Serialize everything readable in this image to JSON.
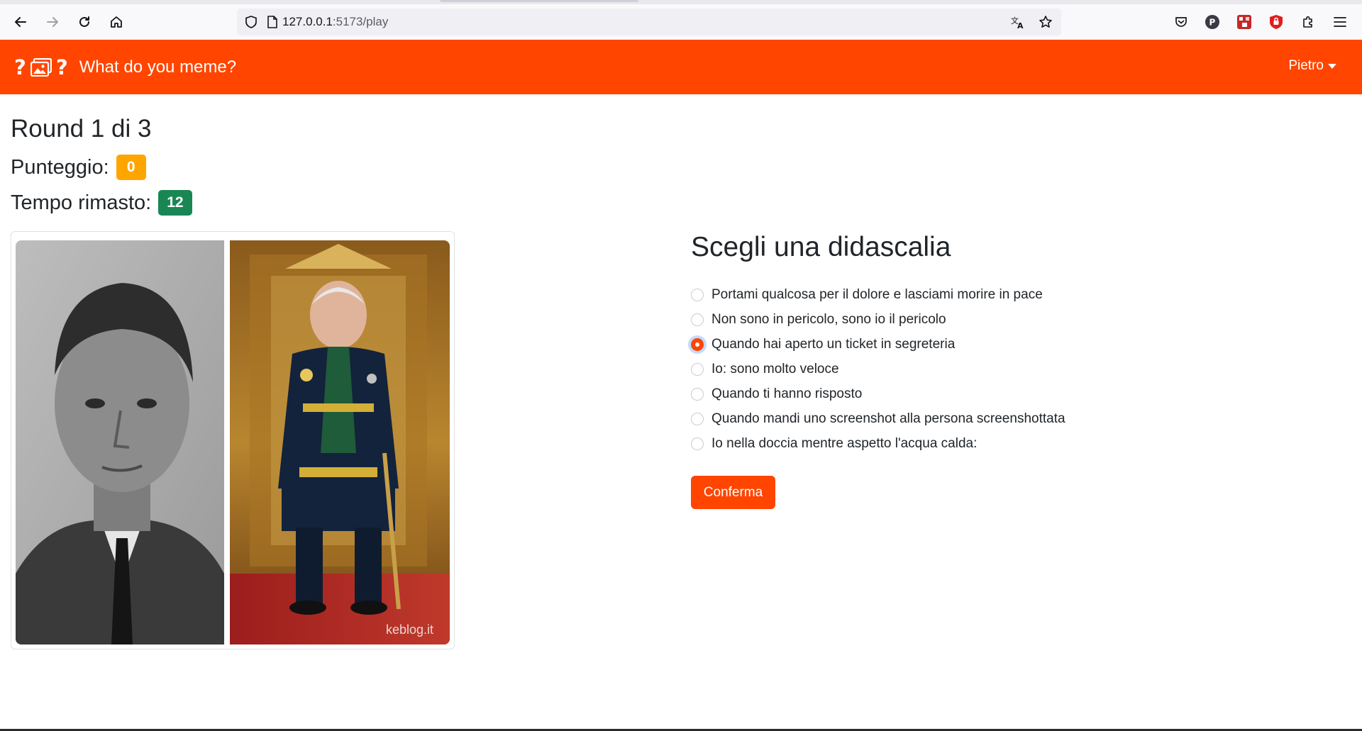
{
  "browser": {
    "url_host": "127.0.0.1",
    "url_path": ":5173/play"
  },
  "navbar": {
    "brand_left": "?",
    "brand_right": "?",
    "title": "What do you meme?",
    "user": "Pietro"
  },
  "game": {
    "round_label": "Round 1 di 3",
    "score_label": "Punteggio:",
    "score_value": "0",
    "time_label": "Tempo rimasto:",
    "time_value": "12"
  },
  "meme": {
    "watermark": "keblog.it"
  },
  "captions": {
    "title": "Scegli una didascalia",
    "options": [
      "Portami qualcosa per il dolore e lasciami morire in pace",
      "Non sono in pericolo, sono io il pericolo",
      "Quando hai aperto un ticket in segreteria",
      "Io: sono molto veloce",
      "Quando ti hanno risposto",
      "Quando mandi uno screenshot alla persona screenshottata",
      "Io nella doccia mentre aspetto l'acqua calda:"
    ],
    "selected_index": 2,
    "confirm_label": "Conferma"
  },
  "colors": {
    "brand": "#ff4500",
    "score_badge": "#ffa500",
    "time_badge": "#198754"
  }
}
